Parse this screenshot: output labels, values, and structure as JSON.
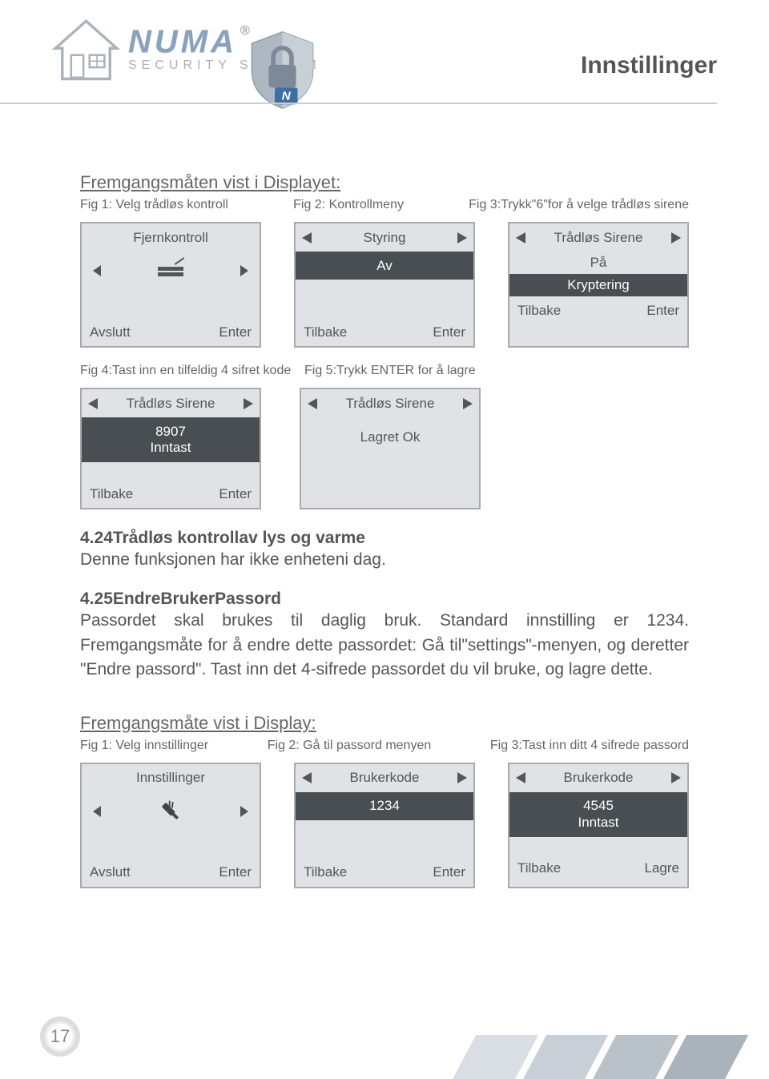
{
  "header": {
    "brand": "NUMA",
    "brand_sub": "SECURITY SYSTEM",
    "title": "Innstillinger",
    "reg": "®"
  },
  "sectionA": {
    "title": "Fremgangsmåten vist i Displayet:",
    "fig1": "Fig 1: Velg trådløs kontroll",
    "fig2": "Fig 2: Kontrollmeny",
    "fig3": "Fig 3:Trykk\"6\"for å velge trådløs sirene",
    "fig4": "Fig 4:Tast inn en tilfeldig 4 sifret kode",
    "fig5": "Fig 5:Trykk ENTER for å lagre"
  },
  "screens1": {
    "s1": {
      "title": "Fjernkontroll",
      "left": "Avslutt",
      "right": "Enter"
    },
    "s2": {
      "title": "Styring",
      "mid": "Av",
      "left": "Tilbake",
      "right": "Enter"
    },
    "s3": {
      "title": "Trådløs Sirene",
      "mid1": "På",
      "mid2": "Kryptering",
      "left": "Tilbake",
      "right": "Enter"
    }
  },
  "screens2": {
    "s4": {
      "title": "Trådløs Sirene",
      "code": "8907",
      "sub": "Inntast",
      "left": "Tilbake",
      "right": "Enter"
    },
    "s5": {
      "title": "Trådløs Sirene",
      "msg": "Lagret Ok"
    }
  },
  "sec424": {
    "heading": "4.24Trådløs kontrollav lys og varme",
    "body": "Denne funksjonen har ikke enheteni dag."
  },
  "sec425": {
    "heading": "4.25EndreBrukerPassord",
    "body": "Passordet skal brukes til daglig bruk. Standard innstilling er 1234. Fremgangsmåte for å endre dette passordet: Gå til\"settings\"-menyen, og deretter \"Endre passord\". Tast inn det 4-sifrede passordet du vil bruke, og lagre dette."
  },
  "sectionB": {
    "title": "Fremgangsmåte vist i Display:",
    "fig1": "Fig 1: Velg innstillinger",
    "fig2": "Fig 2: Gå til passord menyen",
    "fig3": "Fig 3:Tast inn ditt 4 sifrede passord"
  },
  "screens3": {
    "s6": {
      "title": "Innstillinger",
      "left": "Avslutt",
      "right": "Enter"
    },
    "s7": {
      "title": "Brukerkode",
      "code": "1234",
      "left": "Tilbake",
      "right": "Enter"
    },
    "s8": {
      "title": "Brukerkode",
      "code": "4545",
      "sub": "Inntast",
      "left": "Tilbake",
      "right": "Lagre"
    }
  },
  "pagenum": "17"
}
